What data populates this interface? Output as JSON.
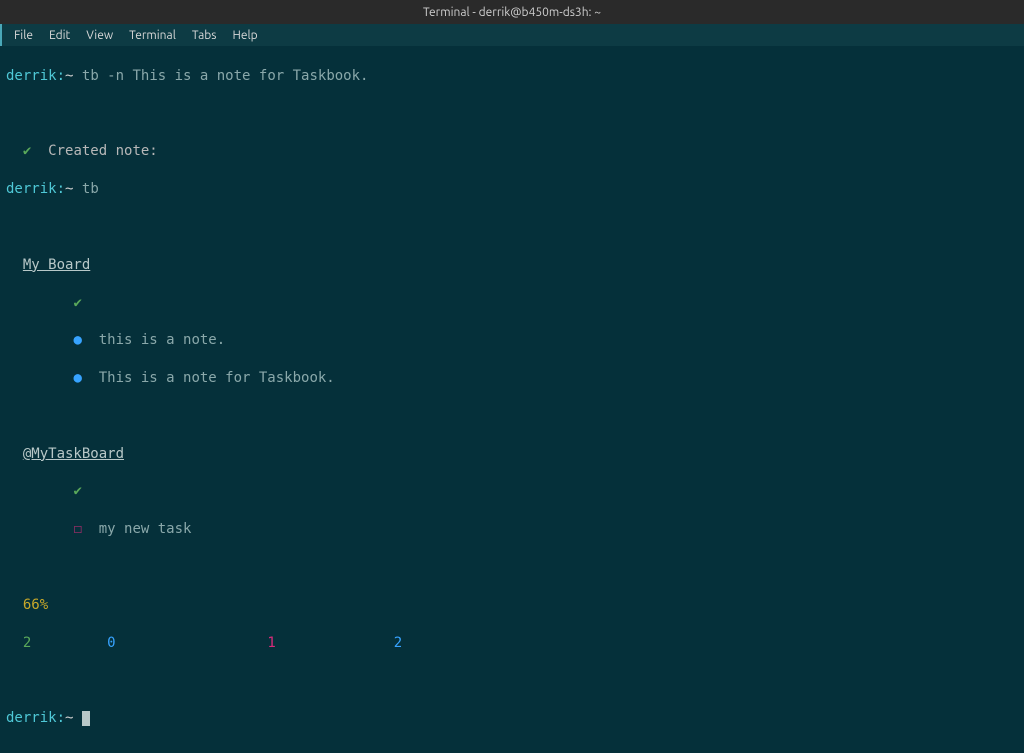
{
  "titlebar": "Terminal - derrik@b450m-ds3h: ~",
  "menu": {
    "file": "File",
    "edit": "Edit",
    "view": "View",
    "terminal": "Terminal",
    "tabs": "Tabs",
    "help": "Help"
  },
  "prompt": {
    "host": "derrik",
    "sep": ":",
    "path": "~"
  },
  "lines": {
    "cmd1": "tb -n This is a note for Taskbook.",
    "created_check": "✔",
    "created_msg": "Created note:",
    "cmd2": "tb",
    "board1_title": "My Board",
    "board1_check": "✔",
    "board1_item1_bullet": "●",
    "board1_item1_text": "this is a note.",
    "board1_item2_bullet": "●",
    "board1_item2_text": "This is a note for Taskbook.",
    "board2_title": "@MyTaskBoard",
    "board2_check": "✔",
    "board2_item1_box": "☐",
    "board2_item1_text": "my new task",
    "percent": "66%",
    "stat1": "2",
    "stat2": "0",
    "stat3": "1",
    "stat4": "2"
  }
}
